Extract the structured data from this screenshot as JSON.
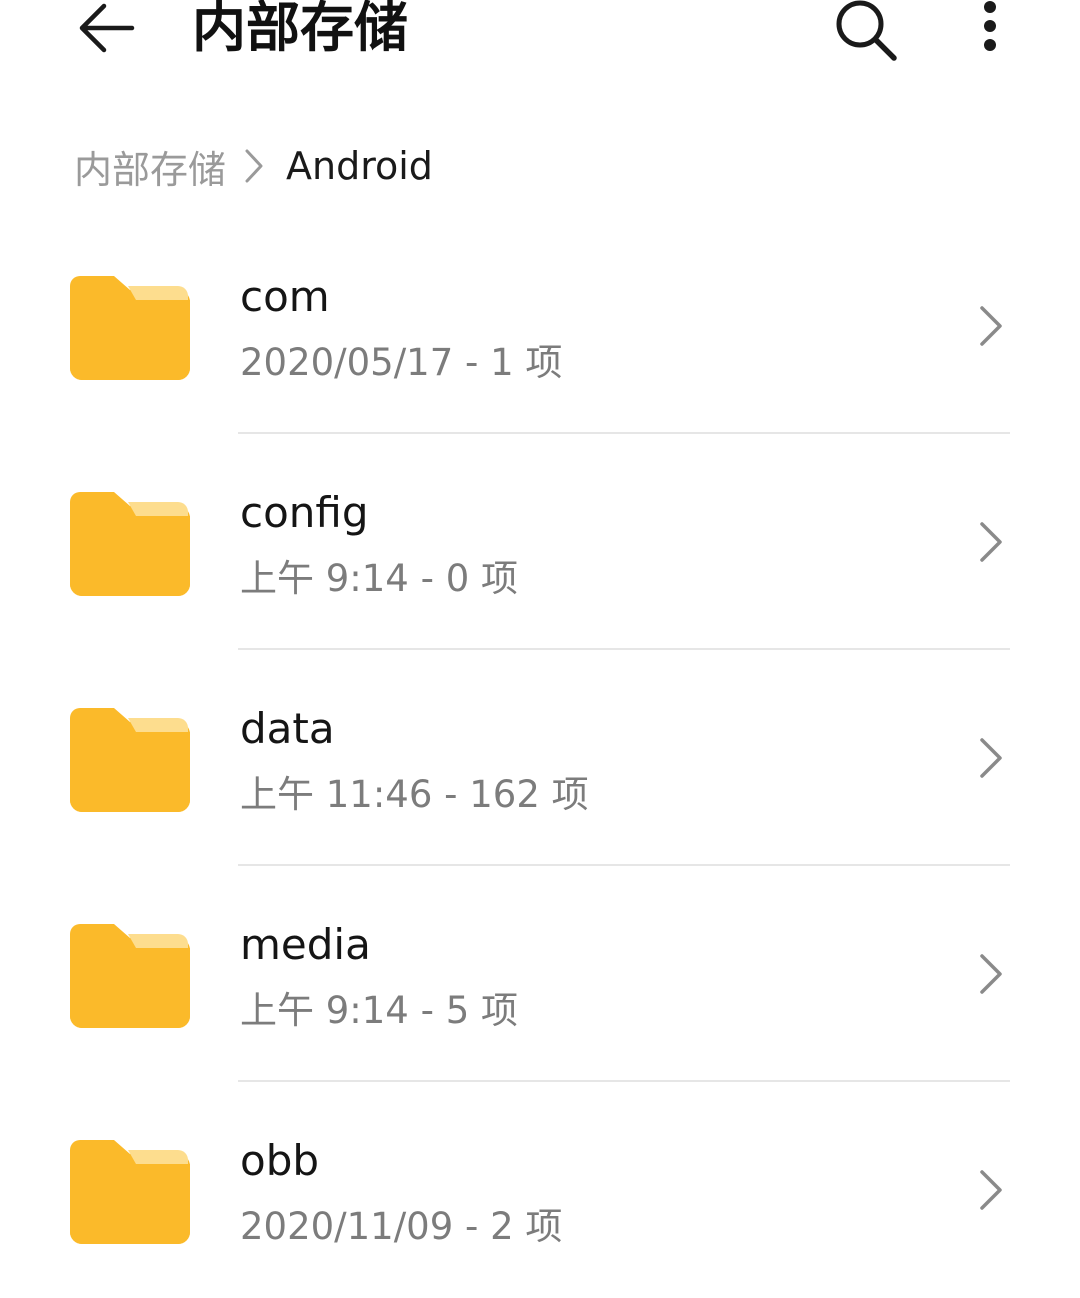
{
  "appbar": {
    "title": "内部存储",
    "back_icon": "arrow-left-icon",
    "search_icon": "search-icon",
    "more_icon": "more-vertical-icon"
  },
  "breadcrumb": {
    "root": "内部存储",
    "current": "Android"
  },
  "colors": {
    "folder": "#FBBA2A",
    "folder_tab": "#FDDD8E",
    "secondary_text": "#7C7C7C",
    "divider": "#E6E6E6"
  },
  "folders": [
    {
      "name": "com",
      "meta": "2020/05/17 - 1 项"
    },
    {
      "name": "config",
      "meta": "上午 9:14  - 0 项"
    },
    {
      "name": "data",
      "meta": "上午 11:46  - 162 项"
    },
    {
      "name": "media",
      "meta": "上午 9:14  - 5 项"
    },
    {
      "name": "obb",
      "meta": "2020/11/09 - 2 项"
    }
  ]
}
